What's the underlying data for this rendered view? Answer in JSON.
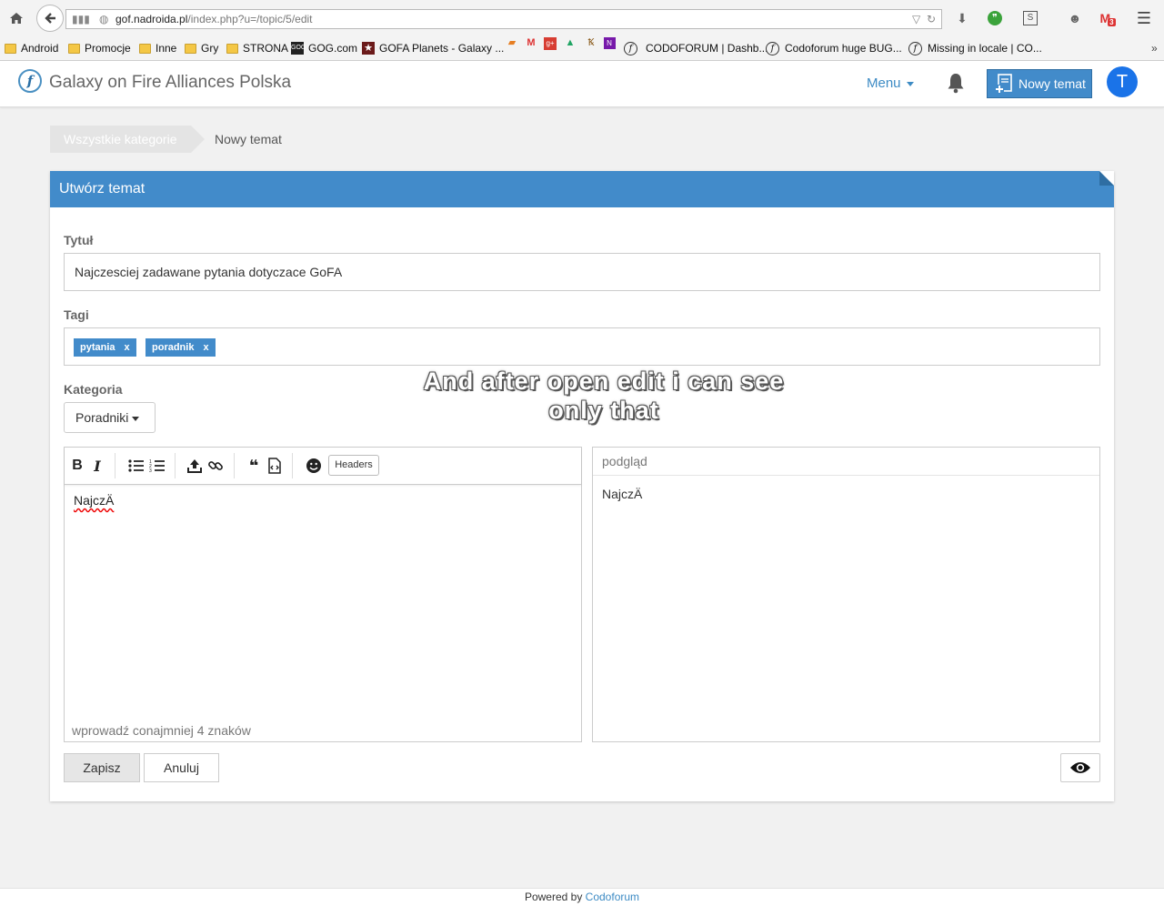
{
  "browser": {
    "url_domain": "gof.nadroida.pl",
    "url_path": "/index.php?u=/topic/5/edit",
    "bookmarks": [
      {
        "label": "Android",
        "kind": "folder"
      },
      {
        "label": "Promocje",
        "kind": "folder"
      },
      {
        "label": "Inne",
        "kind": "folder"
      },
      {
        "label": "Gry",
        "kind": "folder"
      },
      {
        "label": "STRONA",
        "kind": "folder"
      },
      {
        "label": "GOG.com",
        "kind": "site"
      },
      {
        "label": "GOFA Planets - Galaxy ...",
        "kind": "site"
      },
      {
        "label": "CODOFORUM | Dashb...",
        "kind": "site"
      },
      {
        "label": "Codoforum huge BUG...",
        "kind": "site"
      },
      {
        "label": "Missing in locale | CO...",
        "kind": "site"
      }
    ],
    "gmail_badge": "3",
    "colors": {
      "chrome": "#f3f3f3",
      "folder": "#f4c745"
    }
  },
  "header": {
    "site_title": "Galaxy on Fire Alliances Polska",
    "menu_label": "Menu",
    "new_topic_label": "Nowy temat",
    "avatar_letter": "T",
    "colors": {
      "accent": "#428bca",
      "avatar": "#1a73e8"
    }
  },
  "breadcrumb": {
    "first": "Wszystkie kategorie",
    "current": "Nowy temat"
  },
  "form": {
    "panel_title": "Utwórz temat",
    "title_label": "Tytuł",
    "title_value": "Najczesciej zadawane pytania dotyczace GoFA",
    "tags_label": "Tagi",
    "tags": [
      {
        "name": "pytania",
        "remove": "x"
      },
      {
        "name": "poradnik",
        "remove": "x"
      }
    ],
    "category_label": "Kategoria",
    "category_value": "Poradniki",
    "editor_toolbar": [
      "bold-icon",
      "italic-icon",
      "bullet-list-icon",
      "numbered-list-icon",
      "upload-icon",
      "link-icon",
      "quote-icon",
      "code-icon",
      "emoji-icon"
    ],
    "headers_label": "Headers",
    "editor_text": "NajczÄ",
    "editor_hint": "wprowadź conajmniej 4 znaków",
    "preview_title": "podgląd",
    "preview_text": "NajczÄ",
    "save_label": "Zapisz",
    "cancel_label": "Anuluj"
  },
  "overlay_text_line1": "And after open edit i can see",
  "overlay_text_line2": "only that",
  "footer": {
    "powered_by": "Powered by",
    "brand": "Codoforum"
  }
}
